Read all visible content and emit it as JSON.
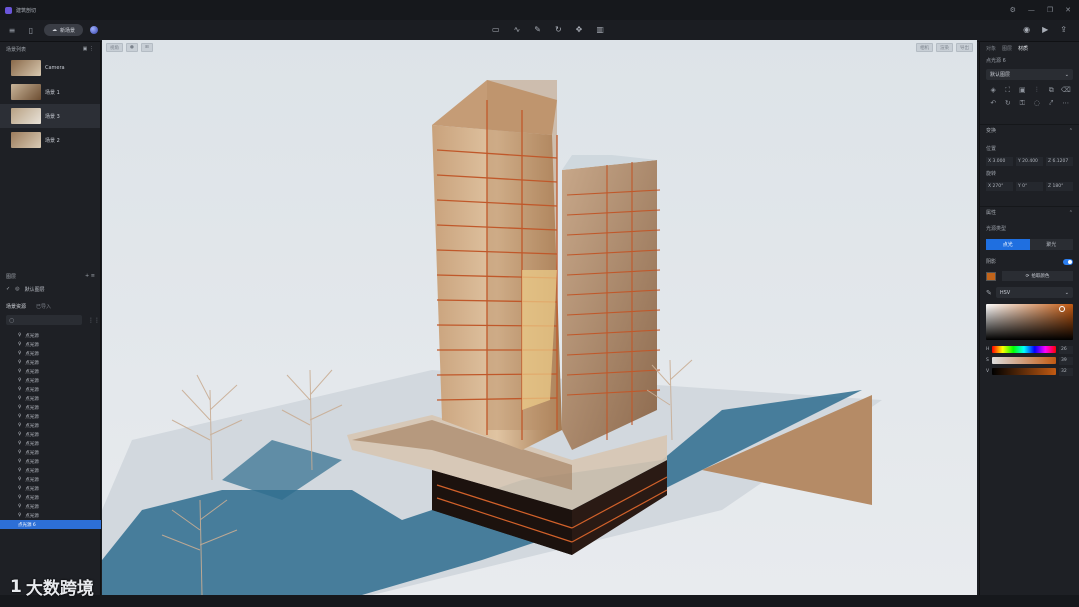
{
  "app": {
    "title": "建筑剖切"
  },
  "toolbar": {
    "new_scene_label": "新场景",
    "left_icons": [
      "menu-icon",
      "file-icon"
    ],
    "center_tools": [
      "box-icon",
      "curve-icon",
      "pen-icon",
      "rotate-icon",
      "move-icon",
      "panel-icon"
    ],
    "right_tools": [
      "camera-icon",
      "video-icon",
      "export-icon"
    ]
  },
  "left_panel": {
    "scenes_title": "场景列表",
    "scenes": [
      {
        "label": "Camera",
        "active": false
      },
      {
        "label": "场景 1",
        "active": false
      },
      {
        "label": "场景 3",
        "active": true
      },
      {
        "label": "场景 2",
        "active": false
      }
    ],
    "layers_title": "图层",
    "layer_default": "默认图层",
    "resources_tab_active": "场景资源",
    "resources_tab_inactive": "已导入",
    "light_items": [
      "点光源",
      "点光源",
      "点光源",
      "点光源",
      "点光源",
      "点光源",
      "点光源",
      "点光源",
      "点光源",
      "点光源",
      "点光源",
      "点光源",
      "点光源",
      "点光源",
      "点光源",
      "点光源",
      "点光源",
      "点光源",
      "点光源",
      "点光源",
      "点光源"
    ],
    "selected_light": "点光源 6"
  },
  "viewport": {
    "top_left_buttons": [
      "视角",
      "●",
      "⊞"
    ],
    "top_right_buttons": [
      "相机",
      "渲染",
      "导出"
    ]
  },
  "right_panel": {
    "tabs": [
      {
        "label": "对象",
        "active": false
      },
      {
        "label": "图层",
        "active": false
      },
      {
        "label": "材质",
        "active": true
      }
    ],
    "object_name": "点光源 6",
    "material_preset": "默认图层",
    "transform_title": "变换",
    "position_label": "位置",
    "position": {
      "x": "X 3.000",
      "y": "Y 20.400",
      "z": "Z 6.1207"
    },
    "rotation_label": "旋转",
    "rotation": {
      "x": "X 270°",
      "y": "Y 0°",
      "z": "Z 180°"
    },
    "attributes_title": "属性",
    "light_type_label": "光源类型",
    "light_type_on": "点光",
    "light_type_off": "聚光",
    "enable_label": "阴影",
    "color_action": "拾取颜色",
    "color_mode": "HSV",
    "hsv": {
      "h": "26",
      "s": "39",
      "v": "32"
    },
    "swatch_color": "#c2641a"
  },
  "watermark": {
    "text": "大数跨境",
    "prefix": "1"
  }
}
